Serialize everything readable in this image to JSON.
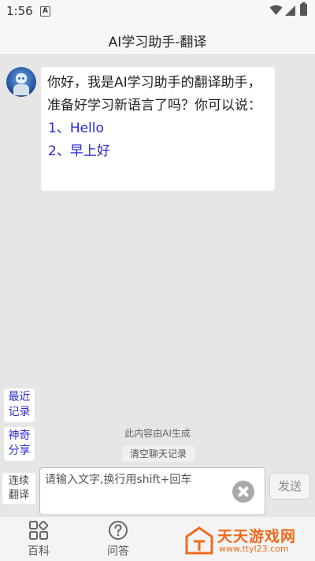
{
  "status_bar": {
    "time": "1:56",
    "notification_badge": "A"
  },
  "header": {
    "title": "AI学习助手-翻译"
  },
  "chat": {
    "message_text": "你好，我是AI学习助手的翻译助手，准备好学习新语言了吗？你可以说：",
    "suggestions": [
      "1、Hello",
      "2、早上好"
    ]
  },
  "side_buttons": {
    "recent_records": "最近\n记录",
    "magic_share": "神奇\n分享",
    "continuous_translate": "连续\n翻译"
  },
  "notice": {
    "ai_generated": "此内容由AI生成",
    "clear_chat": "清空聊天记录"
  },
  "input": {
    "placeholder": "请输入文字,换行用shift+回车",
    "value": ""
  },
  "send": {
    "label": "发送"
  },
  "tabs": [
    {
      "label": "百科",
      "icon": "grid-icon"
    },
    {
      "label": "问答",
      "icon": "question-icon"
    }
  ],
  "watermark": {
    "name": "天天游戏网",
    "url": "www.ttyl23.com"
  },
  "colors": {
    "link_blue": "#2727d9",
    "watermark_orange": "#ef6a1c",
    "background": "#e6e6e6"
  }
}
